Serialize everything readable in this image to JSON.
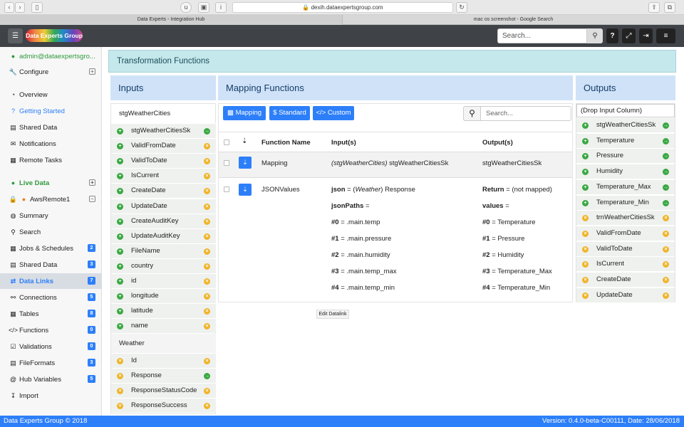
{
  "browser": {
    "url": "dexih.dataexpertsgroup.com",
    "tabs": [
      "Data Experts - Integration Hub",
      "mac os screenshot - Google Search"
    ]
  },
  "navbar": {
    "brand": "Data Experts Group",
    "search_placeholder": "Search...",
    "help_label": "?"
  },
  "sidebar": {
    "user": "admin@dataexpertsgro...",
    "configure": "Configure",
    "overview": "Overview",
    "getting_started": "Getting Started",
    "shared_data": "Shared Data",
    "notifications": "Notifications",
    "remote_tasks": "Remote Tasks",
    "live_data": "Live Data",
    "remote_agent": "AwsRemote1",
    "items": [
      {
        "label": "Summary",
        "badge": ""
      },
      {
        "label": "Search",
        "badge": ""
      },
      {
        "label": "Jobs & Schedules",
        "badge": "2"
      },
      {
        "label": "Shared Data",
        "badge": "3"
      },
      {
        "label": "Data Links",
        "badge": "7"
      },
      {
        "label": "Connections",
        "badge": "5"
      },
      {
        "label": "Tables",
        "badge": "8"
      },
      {
        "label": "Functions",
        "badge": "0"
      },
      {
        "label": "Validations",
        "badge": "0"
      },
      {
        "label": "FileFormats",
        "badge": "3"
      },
      {
        "label": "Hub Variables",
        "badge": "5"
      },
      {
        "label": "Import",
        "badge": ""
      }
    ]
  },
  "page_title": "Transformation Functions",
  "inputs": {
    "title": "Inputs",
    "group1": "stgWeatherCities",
    "group1_cols": [
      "stgWeatherCitiesSk",
      "ValidFromDate",
      "ValidToDate",
      "IsCurrent",
      "CreateDate",
      "UpdateDate",
      "CreateAuditKey",
      "UpdateAuditKey",
      "FileName",
      "country",
      "id",
      "longitude",
      "latitude",
      "name"
    ],
    "group2": "Weather",
    "group2_cols": [
      "Id",
      "Response",
      "ResponseStatusCode",
      "ResponseSuccess"
    ]
  },
  "mapping": {
    "title": "Mapping Functions",
    "btn_mapping": "Mapping",
    "btn_standard": "Standard",
    "btn_custom": "Custom",
    "search_placeholder": "Search...",
    "headers": {
      "name": "Function Name",
      "inputs": "Input(s)",
      "outputs": "Output(s)"
    },
    "row1": {
      "name": "Mapping",
      "input_table": "(stgWeatherCities)",
      "input_col": "stgWeatherCitiesSk",
      "output": "stgWeatherCitiesSk"
    },
    "row2": {
      "name": "JSONValues",
      "json_label": "json",
      "json_eq": "= (",
      "json_table": "Weather",
      "json_rest": ") Response",
      "paths_label": "jsonPaths",
      "paths_eq": "=",
      "return_label": "Return",
      "return_rest": "= (not mapped)",
      "values_label": "values",
      "values_eq": "=",
      "paths": [
        {
          "key": "#0",
          "val": "= .main.temp"
        },
        {
          "key": "#1",
          "val": "= .main.pressure"
        },
        {
          "key": "#2",
          "val": "= .main.humidity"
        },
        {
          "key": "#3",
          "val": "= .main.temp_max"
        },
        {
          "key": "#4",
          "val": "= .main.temp_min"
        }
      ],
      "values": [
        {
          "key": "#0",
          "val": "= Temperature"
        },
        {
          "key": "#1",
          "val": "= Pressure"
        },
        {
          "key": "#2",
          "val": "= Humidity"
        },
        {
          "key": "#3",
          "val": "= Temperature_Max"
        },
        {
          "key": "#4",
          "val": "= Temperature_Min"
        }
      ]
    },
    "tooltip": "Edit Datalink"
  },
  "outputs": {
    "title": "Outputs",
    "drop": "(Drop Input Column)",
    "cols": [
      {
        "label": "stgWeatherCitiesSk",
        "mapped": true
      },
      {
        "label": "Temperature",
        "mapped": true
      },
      {
        "label": "Pressure",
        "mapped": true
      },
      {
        "label": "Humidity",
        "mapped": true
      },
      {
        "label": "Temperature_Max",
        "mapped": true
      },
      {
        "label": "Temperature_Min",
        "mapped": true
      },
      {
        "label": "trnWeatherCitiesSk",
        "mapped": false
      },
      {
        "label": "ValidFromDate",
        "mapped": false
      },
      {
        "label": "ValidToDate",
        "mapped": false
      },
      {
        "label": "IsCurrent",
        "mapped": false
      },
      {
        "label": "CreateDate",
        "mapped": false
      },
      {
        "label": "UpdateDate",
        "mapped": false
      }
    ]
  },
  "footer": {
    "left": "Data Experts Group © 2018",
    "right": "Version: 0.4.0-beta-C00111, Date: 28/06/2018"
  },
  "colors": {
    "accent": "#2d7ff9",
    "green": "#3aa843",
    "orange": "#f0b429",
    "title_bg": "#c5e8ec",
    "navbar": "#3f4246"
  }
}
